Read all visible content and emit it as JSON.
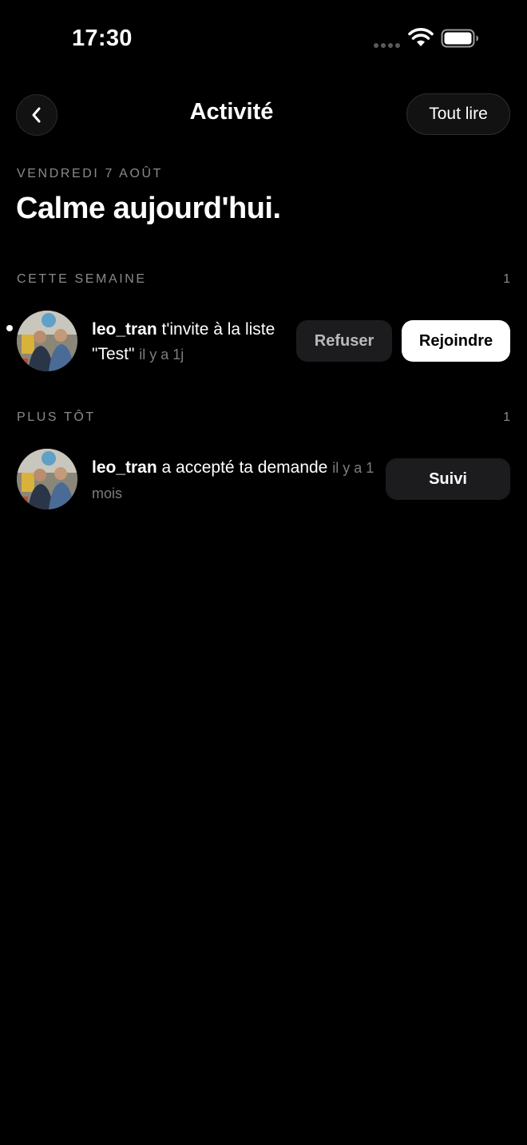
{
  "status_bar": {
    "time": "17:30",
    "icons": [
      "signal-icon",
      "wifi-icon",
      "battery-icon"
    ]
  },
  "header": {
    "back_icon": "chevron-left-icon",
    "title": "Activité",
    "mark_all_label": "Tout lire"
  },
  "date_label": "VENDREDI 7 AOÛT",
  "headline": "Calme aujourd'hui.",
  "sections": [
    {
      "label": "CETTE SEMAINE",
      "count": "1",
      "items": [
        {
          "unread": true,
          "username": "leo_tran",
          "message": "t'invite à la liste \"Test\"",
          "time_ago": "il y a 1j",
          "decline_label": "Refuser",
          "join_label": "Rejoindre"
        }
      ]
    },
    {
      "label": "PLUS TÔT",
      "count": "1",
      "items": [
        {
          "unread": false,
          "username": "leo_tran",
          "message": "a accepté ta demande",
          "time_ago": "il y a 1 mois",
          "follow_label": "Suivi"
        }
      ]
    }
  ],
  "colors": {
    "background": "#000000",
    "secondary_text": "#8a8a8a",
    "button_dark": "#1c1c1e",
    "button_light": "#ffffff"
  }
}
